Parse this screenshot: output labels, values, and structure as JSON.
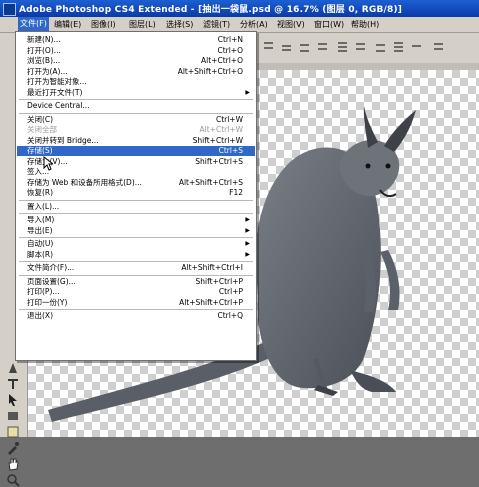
{
  "window": {
    "title": "Adobe Photoshop CS4 Extended - [抽出一袋鼠.psd @ 16.7% (图层 0, RGB/8)]"
  },
  "menubar": [
    {
      "label": "文件(F)",
      "open": true
    },
    {
      "label": "编辑(E)"
    },
    {
      "label": "图像(I)"
    },
    {
      "label": "图层(L)"
    },
    {
      "label": "选择(S)"
    },
    {
      "label": "滤镜(T)"
    },
    {
      "label": "分析(A)"
    },
    {
      "label": "视图(V)"
    },
    {
      "label": "窗口(W)"
    },
    {
      "label": "帮助(H)"
    }
  ],
  "file_menu": {
    "items": [
      {
        "label": "新建(N)...",
        "shortcut": "Ctrl+N"
      },
      {
        "label": "打开(O)...",
        "shortcut": "Ctrl+O"
      },
      {
        "label": "浏览(B)...",
        "shortcut": "Alt+Ctrl+O"
      },
      {
        "label": "打开为(A)...",
        "shortcut": "Alt+Shift+Ctrl+O"
      },
      {
        "label": "打开为智能对象...",
        "shortcut": ""
      },
      {
        "label": "最近打开文件(T)",
        "shortcut": "",
        "submenu": true
      },
      {
        "sep": true
      },
      {
        "label": "Device Central...",
        "shortcut": ""
      },
      {
        "sep": true
      },
      {
        "label": "关闭(C)",
        "shortcut": "Ctrl+W"
      },
      {
        "label": "关闭全部",
        "shortcut": "Alt+Ctrl+W",
        "disabled": true
      },
      {
        "label": "关闭并转到 Bridge...",
        "shortcut": "Shift+Ctrl+W"
      },
      {
        "label": "存储(S)",
        "shortcut": "Ctrl+S",
        "highlighted": true
      },
      {
        "label": "存储为(V)...",
        "shortcut": "Shift+Ctrl+S"
      },
      {
        "label": "签入...",
        "shortcut": ""
      },
      {
        "label": "存储为 Web 和设备所用格式(D)...",
        "shortcut": "Alt+Shift+Ctrl+S"
      },
      {
        "label": "恢复(R)",
        "shortcut": "F12"
      },
      {
        "sep": true
      },
      {
        "label": "置入(L)...",
        "shortcut": ""
      },
      {
        "sep": true
      },
      {
        "label": "导入(M)",
        "shortcut": "",
        "submenu": true
      },
      {
        "label": "导出(E)",
        "shortcut": "",
        "submenu": true
      },
      {
        "sep": true
      },
      {
        "label": "自动(U)",
        "shortcut": "",
        "submenu": true
      },
      {
        "label": "脚本(R)",
        "shortcut": "",
        "submenu": true
      },
      {
        "sep": true
      },
      {
        "label": "文件简介(F)...",
        "shortcut": "Alt+Shift+Ctrl+I"
      },
      {
        "sep": true
      },
      {
        "label": "页面设置(G)...",
        "shortcut": "Shift+Ctrl+P"
      },
      {
        "label": "打印(P)...",
        "shortcut": "Ctrl+P"
      },
      {
        "label": "打印一份(Y)",
        "shortcut": "Alt+Shift+Ctrl+P"
      },
      {
        "sep": true
      },
      {
        "label": "退出(X)",
        "shortcut": "Ctrl+Q"
      }
    ]
  },
  "colors": {
    "titlebar": "#1d5fd1",
    "menu_highlight": "#3167c6",
    "chrome": "#d4d0c8"
  }
}
